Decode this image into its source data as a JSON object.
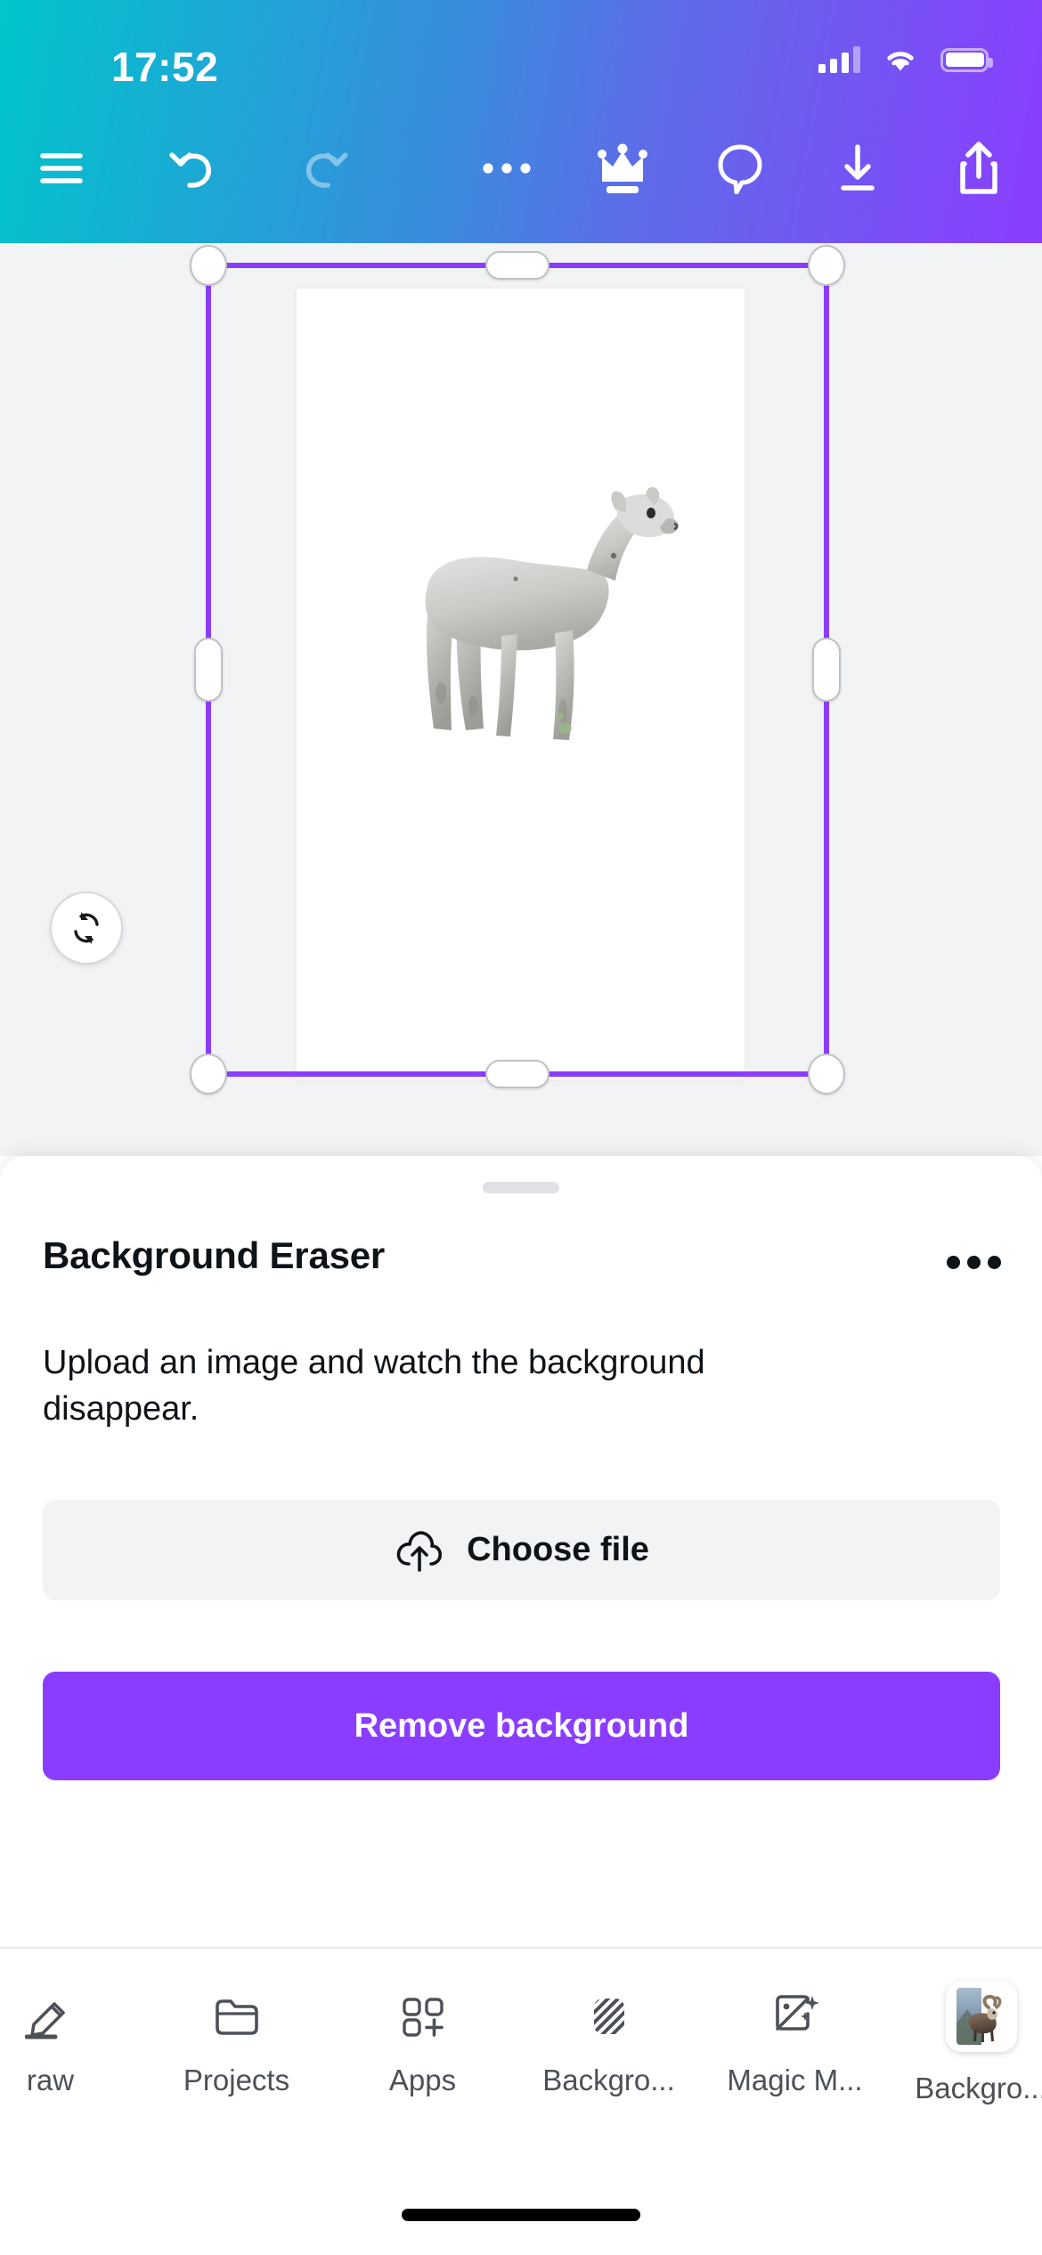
{
  "status_bar": {
    "time": "17:52",
    "cellular_icon": "cellular-bars-icon",
    "wifi_icon": "wifi-icon",
    "battery_icon": "battery-icon"
  },
  "toolbar": {
    "menu_icon": "hamburger-menu-icon",
    "undo_icon": "undo-icon",
    "redo_icon": "redo-icon",
    "more_icon": "more-options-icon",
    "crown_icon": "crown-icon",
    "comment_icon": "comment-icon",
    "download_icon": "download-icon",
    "share_icon": "share-icon"
  },
  "canvas": {
    "rotate_icon": "rotate-icon",
    "element_alt": "alpaca-cutout-image",
    "selection_color": "#8B3DFF"
  },
  "sheet": {
    "title": "Background Eraser",
    "more_icon": "more-options-icon",
    "description": "Upload an image and watch the background disappear.",
    "choose_file": {
      "label": "Choose file",
      "icon": "cloud-upload-icon"
    },
    "primary_action": {
      "label": "Remove background",
      "color": "#8B3DFF"
    }
  },
  "bottom_nav": {
    "items": [
      {
        "label": "raw",
        "icon": "pen-draw-icon",
        "active": false
      },
      {
        "label": "Projects",
        "icon": "folder-icon",
        "active": false
      },
      {
        "label": "Apps",
        "icon": "apps-grid-plus-icon",
        "active": false
      },
      {
        "label": "Backgro...",
        "icon": "diagonal-stripes-icon",
        "active": false
      },
      {
        "label": "Magic M...",
        "icon": "magic-media-icon",
        "active": false
      },
      {
        "label": "Backgro...",
        "icon": "ram-photo-thumbnail",
        "active": true
      }
    ]
  }
}
